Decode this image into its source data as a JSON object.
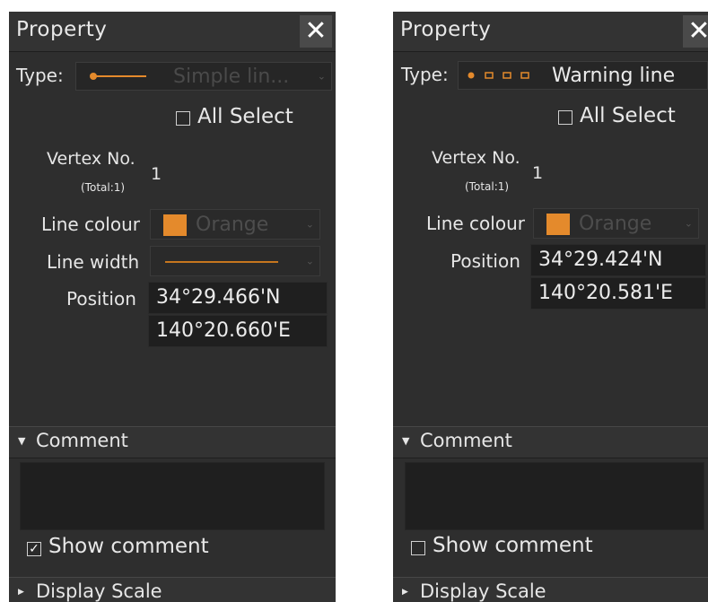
{
  "left_panel": {
    "title": "Property",
    "close_glyph": "✕",
    "type_label": "Type:",
    "type_value": "Simple lin...",
    "all_select_label": "All Select",
    "all_select_checked": false,
    "vertex_label": "Vertex No.",
    "vertex_total": "(Total:1)",
    "vertex_value": "1",
    "line_colour_label": "Line colour",
    "line_colour_value": "Orange",
    "line_width_label": "Line width",
    "position_label": "Position",
    "lat": "34°29.466'N",
    "lon": "140°20.660'E",
    "comment_header": "Comment",
    "show_comment_label": "Show comment",
    "show_comment_checked": true,
    "display_scale_header": "Display Scale"
  },
  "right_panel": {
    "title": "Property",
    "close_glyph": "✕",
    "type_label": "Type:",
    "type_value": "Warning line",
    "all_select_label": "All Select",
    "all_select_checked": false,
    "vertex_label": "Vertex No.",
    "vertex_total": "(Total:1)",
    "vertex_value": "1",
    "line_colour_label": "Line colour",
    "line_colour_value": "Orange",
    "position_label": "Position",
    "lat": "34°29.424'N",
    "lon": "140°20.581'E",
    "comment_header": "Comment",
    "show_comment_label": "Show comment",
    "show_comment_checked": false,
    "display_scale_header": "Display Scale"
  },
  "icons": {
    "checkmark": "✓",
    "chevron_down": "⌄",
    "triangle_down": "▼",
    "triangle_right": "▶"
  },
  "colors": {
    "accent_orange": "#e48a2c",
    "panel_bg": "#2e2e2e",
    "field_bg": "#1f1f1f"
  }
}
